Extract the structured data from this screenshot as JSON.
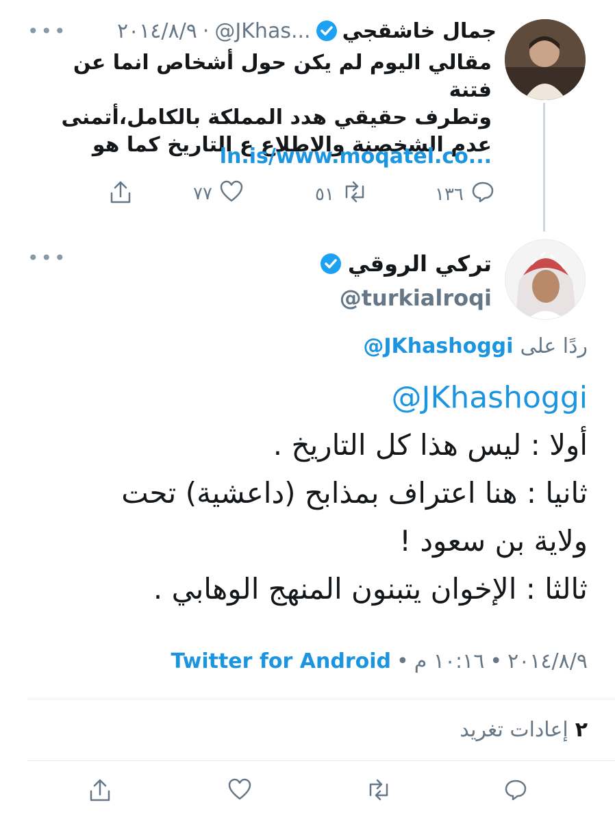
{
  "parent_tweet": {
    "name": "جمال خاشقجي",
    "handle": "@JKhas...",
    "date": "٢٠١٤/٨/٩",
    "more": "•••",
    "text_lines": [
      "مقالي اليوم لم يكن حول أشخاص انما عن فتنة",
      "وتطرف حقيقي هدد المملكة بالكامل،أتمنى",
      "عدم الشخصنة والاطلاع ع التاريخ كما هو"
    ],
    "link": "ln.is/www.moqatel.co...",
    "actions": {
      "reply_count": "١٣٦",
      "retweet_count": "٥١",
      "like_count": "٧٧"
    }
  },
  "main_tweet": {
    "name": "تركي الروقي",
    "handle": "@turkialroqi",
    "more": "•••",
    "reply_label": "ردًا على",
    "reply_mention": "@JKhashoggi",
    "mention": "@JKhashoggi",
    "body_lines": [
      "أولا : ليس هذا كل التاريخ .",
      "ثانيا : هنا اعتراف بمذابح (داعشية) تحت",
      "ولاية بن سعود !",
      "ثالثا : الإخوان يتبنون المنهج الوهابي ."
    ],
    "date": "٢٠١٤/٨/٩",
    "time": "١٠:١٦ م",
    "separator": "•",
    "source": "Twitter for Android",
    "retweet_count": "٢",
    "retweet_label": "إعادات تغريد"
  },
  "colors": {
    "accent": "#1b95e0",
    "verified": "#1da1f2",
    "secondary_text": "#657786",
    "divider": "#e6ecf0"
  }
}
